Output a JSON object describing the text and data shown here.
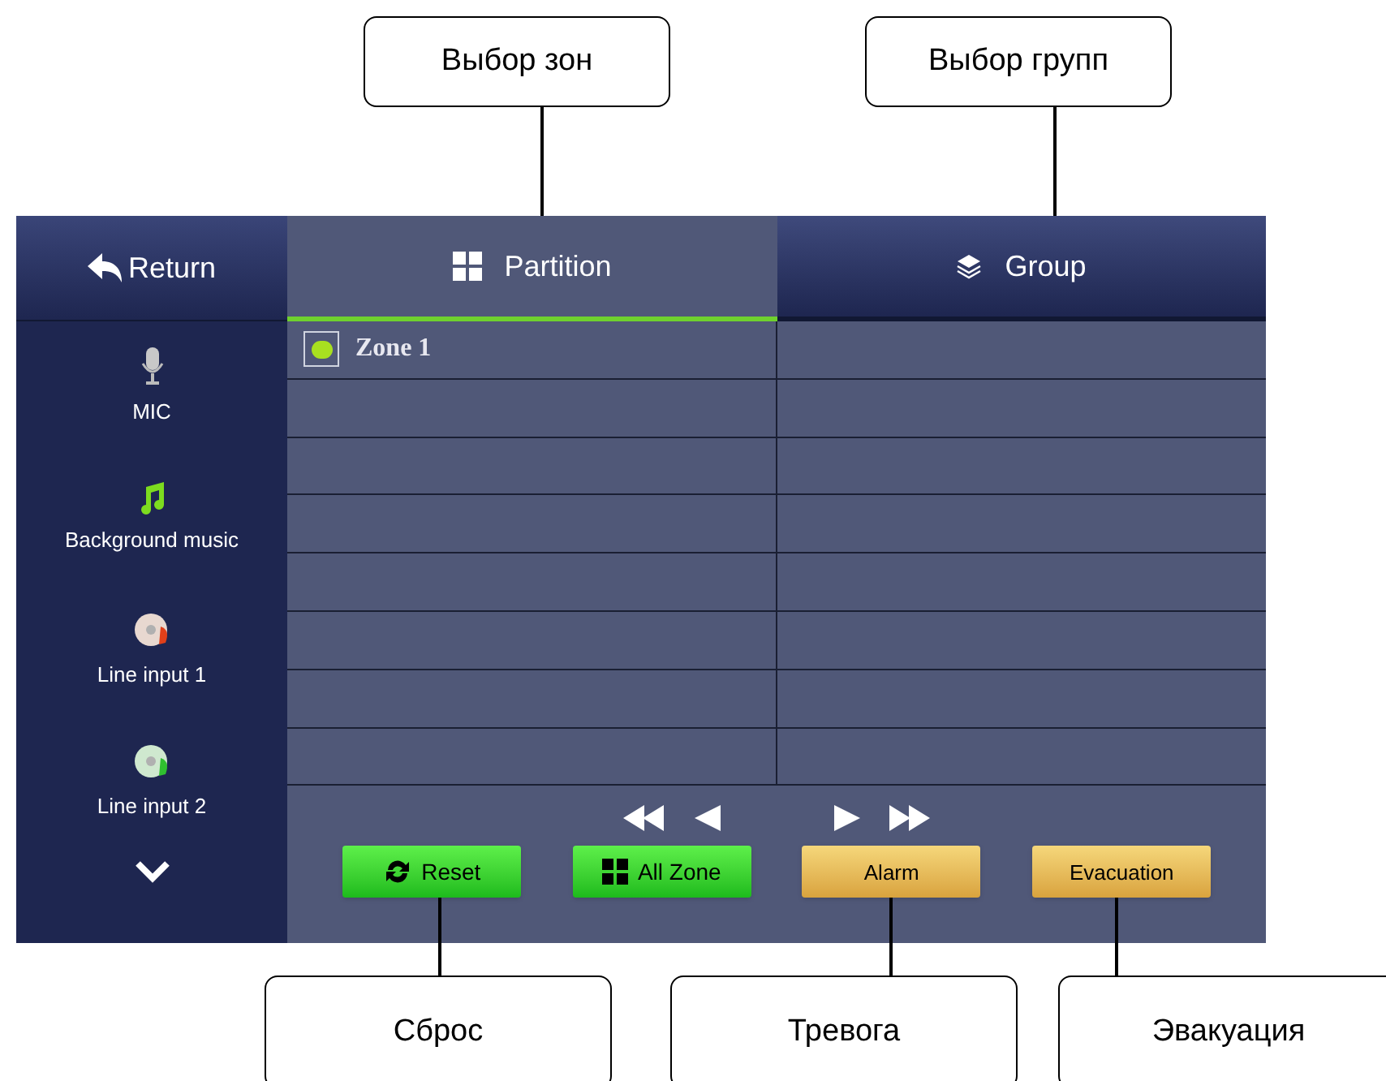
{
  "callouts_top": [
    {
      "text": "Выбор зон"
    },
    {
      "text": "Выбор групп"
    }
  ],
  "return_button": {
    "label": "Return"
  },
  "tabs": [
    {
      "label": "Partition",
      "kind": "grid",
      "selected": true
    },
    {
      "label": "Group",
      "kind": "layers",
      "selected": false
    }
  ],
  "sidebar": {
    "items": [
      {
        "label": "MIC",
        "kind": "mic"
      },
      {
        "label": "Background music",
        "kind": "music"
      },
      {
        "label": "Line input 1",
        "kind": "disc-red"
      },
      {
        "label": "Line input 2",
        "kind": "disc-green"
      }
    ]
  },
  "zones": [
    {
      "label": "Zone 1",
      "checked": true
    }
  ],
  "buttons": [
    {
      "label": "Reset",
      "kind": "green"
    },
    {
      "label": "All Zone",
      "kind": "green"
    },
    {
      "label": "Alarm",
      "kind": "gold"
    },
    {
      "label": "Evacuation",
      "kind": "gold"
    }
  ],
  "callouts_bottom": [
    {
      "text": "Сброс"
    },
    {
      "text": "Тревога"
    },
    {
      "text": "Эвакуация"
    }
  ]
}
